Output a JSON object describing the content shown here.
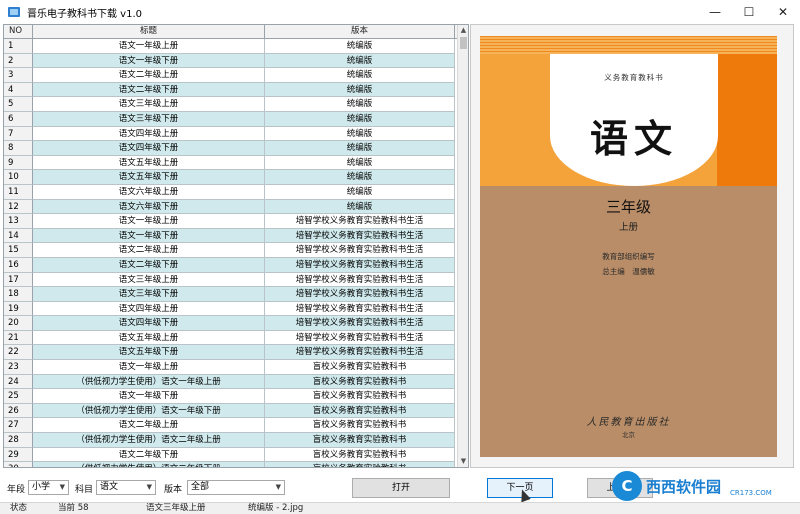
{
  "window": {
    "title": "晋乐电子教科书下载 v1.0",
    "minimize": "—",
    "maximize": "☐",
    "close": "✕"
  },
  "table": {
    "headers": {
      "no": "NO",
      "title": "标题",
      "version": "版本"
    },
    "rows": [
      {
        "no": "1",
        "title": "语文一年级上册",
        "version": "统编版"
      },
      {
        "no": "2",
        "title": "语文一年级下册",
        "version": "统编版"
      },
      {
        "no": "3",
        "title": "语文二年级上册",
        "version": "统编版"
      },
      {
        "no": "4",
        "title": "语文二年级下册",
        "version": "统编版"
      },
      {
        "no": "5",
        "title": "语文三年级上册",
        "version": "统编版"
      },
      {
        "no": "6",
        "title": "语文三年级下册",
        "version": "统编版"
      },
      {
        "no": "7",
        "title": "语文四年级上册",
        "version": "统编版"
      },
      {
        "no": "8",
        "title": "语文四年级下册",
        "version": "统编版"
      },
      {
        "no": "9",
        "title": "语文五年级上册",
        "version": "统编版"
      },
      {
        "no": "10",
        "title": "语文五年级下册",
        "version": "统编版"
      },
      {
        "no": "11",
        "title": "语文六年级上册",
        "version": "统编版"
      },
      {
        "no": "12",
        "title": "语文六年级下册",
        "version": "统编版"
      },
      {
        "no": "13",
        "title": "语文一年级上册",
        "version": "培智学校义务教育实验教科书生活"
      },
      {
        "no": "14",
        "title": "语文一年级下册",
        "version": "培智学校义务教育实验教科书生活"
      },
      {
        "no": "15",
        "title": "语文二年级上册",
        "version": "培智学校义务教育实验教科书生活"
      },
      {
        "no": "16",
        "title": "语文二年级下册",
        "version": "培智学校义务教育实验教科书生活"
      },
      {
        "no": "17",
        "title": "语文三年级上册",
        "version": "培智学校义务教育实验教科书生活"
      },
      {
        "no": "18",
        "title": "语文三年级下册",
        "version": "培智学校义务教育实验教科书生活"
      },
      {
        "no": "19",
        "title": "语文四年级上册",
        "version": "培智学校义务教育实验教科书生活"
      },
      {
        "no": "20",
        "title": "语文四年级下册",
        "version": "培智学校义务教育实验教科书生活"
      },
      {
        "no": "21",
        "title": "语文五年级上册",
        "version": "培智学校义务教育实验教科书生活"
      },
      {
        "no": "22",
        "title": "语文五年级下册",
        "version": "培智学校义务教育实验教科书生活"
      },
      {
        "no": "23",
        "title": "语文一年级上册",
        "version": "盲校义务教育实验教科书"
      },
      {
        "no": "24",
        "title": "（供低视力学生使用）语文一年级上册",
        "version": "盲校义务教育实验教科书"
      },
      {
        "no": "25",
        "title": "语文一年级下册",
        "version": "盲校义务教育实验教科书"
      },
      {
        "no": "26",
        "title": "（供低视力学生使用）语文一年级下册",
        "version": "盲校义务教育实验教科书"
      },
      {
        "no": "27",
        "title": "语文二年级上册",
        "version": "盲校义务教育实验教科书"
      },
      {
        "no": "28",
        "title": "（供低视力学生使用）语文二年级上册",
        "version": "盲校义务教育实验教科书"
      },
      {
        "no": "29",
        "title": "语文二年级下册",
        "version": "盲校义务教育实验教科书"
      },
      {
        "no": "30",
        "title": "（供低视力学生使用）语文二年级下册",
        "version": "盲校义务教育实验教科书"
      }
    ]
  },
  "cover": {
    "series": "义务教育教科书",
    "subject": "语文",
    "grade": "三年级",
    "volume": "上册",
    "compiler": "教育部组织编写",
    "editors": "总主编　温儒敏",
    "publisher": "人民教育出版社",
    "publisher_city": "北京"
  },
  "controls": {
    "stage_label": "年段",
    "stage_value": "小学",
    "subject_label": "科目",
    "subject_value": "语文",
    "version_label": "版本",
    "version_value": "全部",
    "open_button": "打开",
    "next_button": "下一页",
    "prev_button": "上一页"
  },
  "status": {
    "label": "状态",
    "current": "当前 58",
    "book": "语文三年级上册",
    "file": "统编版 - 2.jpg"
  },
  "watermark": {
    "logo": "C",
    "name": "西西软件园",
    "url": "CR173.COM"
  }
}
